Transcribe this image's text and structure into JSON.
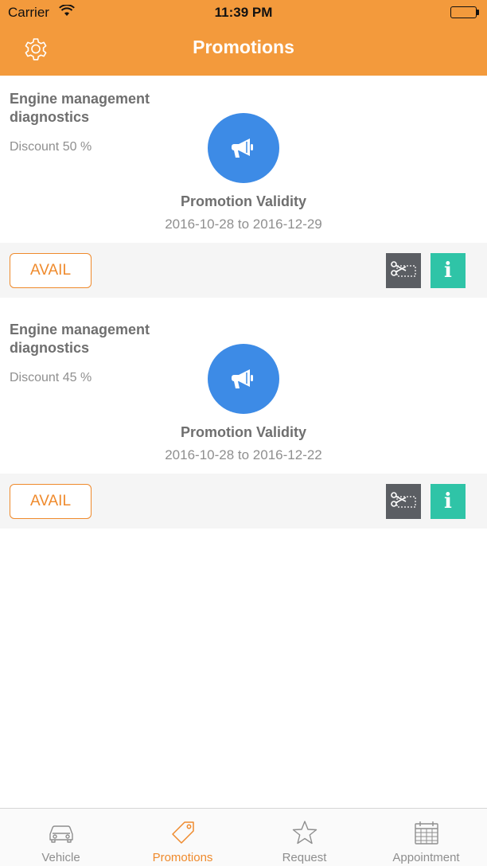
{
  "status_bar": {
    "carrier": "Carrier",
    "time": "11:39 PM",
    "battery_level": 1.0
  },
  "header": {
    "title": "Promotions",
    "settings_icon": "gear-icon"
  },
  "colors": {
    "accent": "#f39a3c",
    "promo_icon_bg": "#3d8be6",
    "coupon_btn_bg": "#5b5e63",
    "info_btn_bg": "#2fc4a7",
    "active_tab": "#ef8a2c"
  },
  "promotions": [
    {
      "title": "Engine management diagnostics",
      "discount": "Discount 50 %",
      "icon": "megaphone-icon",
      "validity_label": "Promotion Validity",
      "validity_range": "2016-10-28 to 2016-12-29",
      "avail_label": "AVAIL",
      "info_label": "i"
    },
    {
      "title": "Engine management diagnostics",
      "discount": "Discount 45 %",
      "icon": "megaphone-icon",
      "validity_label": "Promotion Validity",
      "validity_range": "2016-10-28 to 2016-12-22",
      "avail_label": "AVAIL",
      "info_label": "i"
    }
  ],
  "tabs": [
    {
      "label": "Vehicle",
      "icon": "car-icon",
      "active": false
    },
    {
      "label": "Promotions",
      "icon": "tag-icon",
      "active": true
    },
    {
      "label": "Request",
      "icon": "star-icon",
      "active": false
    },
    {
      "label": "Appointment",
      "icon": "calendar-icon",
      "active": false
    }
  ]
}
